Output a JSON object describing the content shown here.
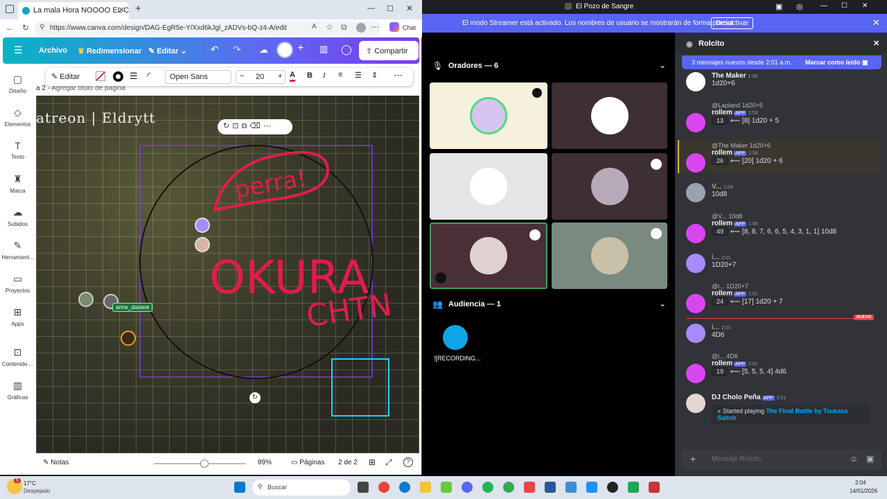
{
  "browser": {
    "tab_title": "La mala Hora NOOOO EL CROW M",
    "url": "https://www.canva.com/design/DAG-EgR5e-Y/Xxd6kJgl_zADVs-bQ-z4-A/edit",
    "chat_label": "Chat"
  },
  "canva": {
    "archivo": "Archivo",
    "redimensionar": "Redimensionar",
    "editar": "Editar",
    "compartir": "Compartir",
    "sidebar": [
      "Diseño",
      "Elementos",
      "Texto",
      "Marca",
      "Subidos",
      "Herramient...",
      "Proyectos",
      "Apps",
      "Contenido ...",
      "Gráficas"
    ],
    "editbar": {
      "editar": "Editar",
      "font": "Open Sans",
      "size": "20"
    },
    "page_label": "a 2 - ",
    "page_title_placeholder": "Agregar título de página",
    "map_text": "atreon | Eldrytt",
    "token_label": "arine_dasiere",
    "handwriting1": "perra!",
    "handwriting2": "OKURA",
    "handwriting3": "CHTN",
    "notas": "Notas",
    "zoom": "89%",
    "paginas": "Páginas",
    "page_count": "2 de 2"
  },
  "discord": {
    "window_title": "El Pozo de Sangre",
    "streamer_text": "El modo Streamer está activado. Los nombres de usuario se mostrarán de forma parcial.",
    "desactivar": "Desactivar",
    "oradores": "Oradores — 6",
    "audiencia": "Audiencia — 1",
    "recording": "![RECORDING...",
    "channel": "Rolcito",
    "new_msgs": "3 mensajes nuevos desde 2:01 a.m.",
    "mark_read": "Marcar como leído",
    "input_placeholder": "Mensaje Rolcito",
    "nuevo": "NUEVO",
    "messages": [
      {
        "name": "The Maker",
        "time": "1:58",
        "text": "1d20+6"
      },
      {
        "reply": "@Lapland 1d20+5",
        "name": "rollem",
        "app": "APP",
        "time": "1:58",
        "num": "13",
        "text": "⟵ [8] 1d20 + 5"
      },
      {
        "reply": "@The Maker 1d20+6",
        "name": "rollem",
        "app": "APP",
        "time": "1:58",
        "num": "26",
        "text": "⟵ [20] 1d20 + 6"
      },
      {
        "name": "V...",
        "time": "1:59",
        "text": "10d8"
      },
      {
        "reply": "@V... 10d8",
        "name": "rollem",
        "app": "APP",
        "time": "1:59",
        "num": "49",
        "text": "⟵ [8, 8, 7, 6, 6, 5, 4, 3, 1, 1] 10d8"
      },
      {
        "name": "i...",
        "time": "2:01",
        "text": "1D20+7"
      },
      {
        "reply": "@i... 1D20+7",
        "name": "rollem",
        "app": "APP",
        "time": "2:01",
        "num": "24",
        "text": "⟵ [17] 1d20 + 7"
      },
      {
        "name": "i...",
        "time": "2:01",
        "text": "4D6"
      },
      {
        "reply": "@i... 4D6",
        "name": "rollem",
        "app": "APP",
        "time": "2:01",
        "num": "19",
        "text": "⟵ [5, 5, 5, 4] 4d6"
      },
      {
        "name": "DJ Cholo Peña",
        "app": "APP",
        "time": "2:01",
        "text": ""
      }
    ],
    "activity_prefix": "Started playing ",
    "activity": "The Final Battle by Tsukasa Saitoh"
  },
  "taskbar": {
    "temp": "17°C",
    "weather": "Despejado",
    "search": "Buscar",
    "time": "2:04",
    "date": "14/01/2026",
    "badge": "5"
  }
}
